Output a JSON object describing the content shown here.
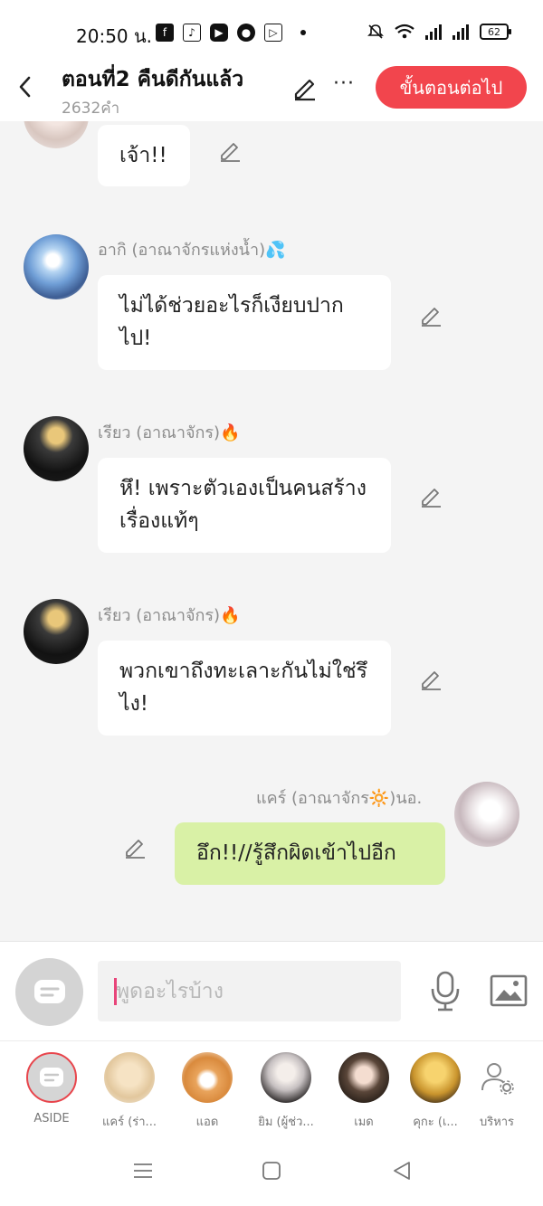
{
  "status_bar": {
    "time": "20:50 น.",
    "battery": "62",
    "icons": [
      "facebook-icon",
      "tiktok-icon",
      "youtube-icon",
      "app-icon",
      "media-icon",
      "mute-icon",
      "wifi-icon",
      "signal-icon",
      "signal-icon",
      "battery-icon"
    ]
  },
  "header": {
    "title": "ตอนที่2 คืนดีกันแล้ว",
    "word_count": "2632คำ",
    "more_label": "···",
    "next_button": "ขั้นตอนต่อไป"
  },
  "messages": [
    {
      "sender": "",
      "text": "เจ้า!!",
      "side": "left"
    },
    {
      "sender": "อากิ (อาณาจักรแห่งน้ำ)💦",
      "text": "ไม่ได้ช่วยอะไรก็เงียบปากไป!",
      "side": "left"
    },
    {
      "sender": "เรียว (อาณาจักร)🔥",
      "text": "หึ! เพราะตัวเองเป็นคนสร้างเรื่องแท้ๆ",
      "side": "left"
    },
    {
      "sender": "เรียว (อาณาจักร)🔥",
      "text": "พวกเขาถึงทะเลาะกันไม่ใช่รึไง!",
      "side": "left"
    },
    {
      "sender": "แคร์ (อาณาจักร🔆)นอ.",
      "text": "อึก!!//รู้สึกผิดเข้าไปอีก",
      "side": "right"
    }
  ],
  "composer": {
    "placeholder": "พูดอะไรบ้าง"
  },
  "characters": [
    {
      "label": "ASIDE"
    },
    {
      "label": "แคร์ (ร่า..."
    },
    {
      "label": "แอด"
    },
    {
      "label": "ยิม (ผู้ช่ว..."
    },
    {
      "label": "เมด"
    },
    {
      "label": "คุกะ (เ..."
    },
    {
      "label": "บริหาร"
    }
  ],
  "colors": {
    "accent": "#f2454d",
    "my_bubble": "#d9f1a6",
    "background": "#f4f4f4"
  }
}
